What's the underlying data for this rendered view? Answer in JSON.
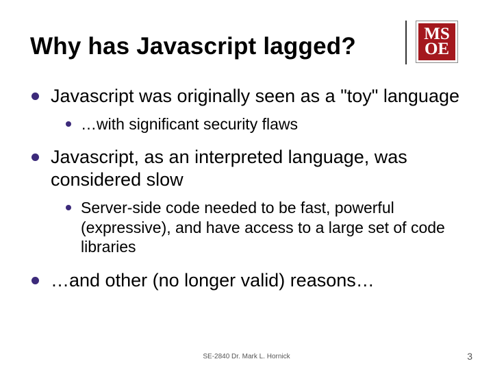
{
  "logo": {
    "line1": "MS",
    "line2": "OE"
  },
  "title": "Why has Javascript lagged?",
  "bullets": [
    {
      "text": "Javascript was originally seen as a \"toy\" language",
      "sub": [
        {
          "text": "…with significant security flaws"
        }
      ]
    },
    {
      "text": "Javascript, as an interpreted language, was considered slow",
      "sub": [
        {
          "text": "Server-side code needed to be fast, powerful (expressive), and have access to a large set of code libraries"
        }
      ]
    },
    {
      "text": "…and other (no longer valid) reasons…",
      "sub": []
    }
  ],
  "footer": "SE-2840 Dr. Mark L. Hornick",
  "page_number": "3"
}
